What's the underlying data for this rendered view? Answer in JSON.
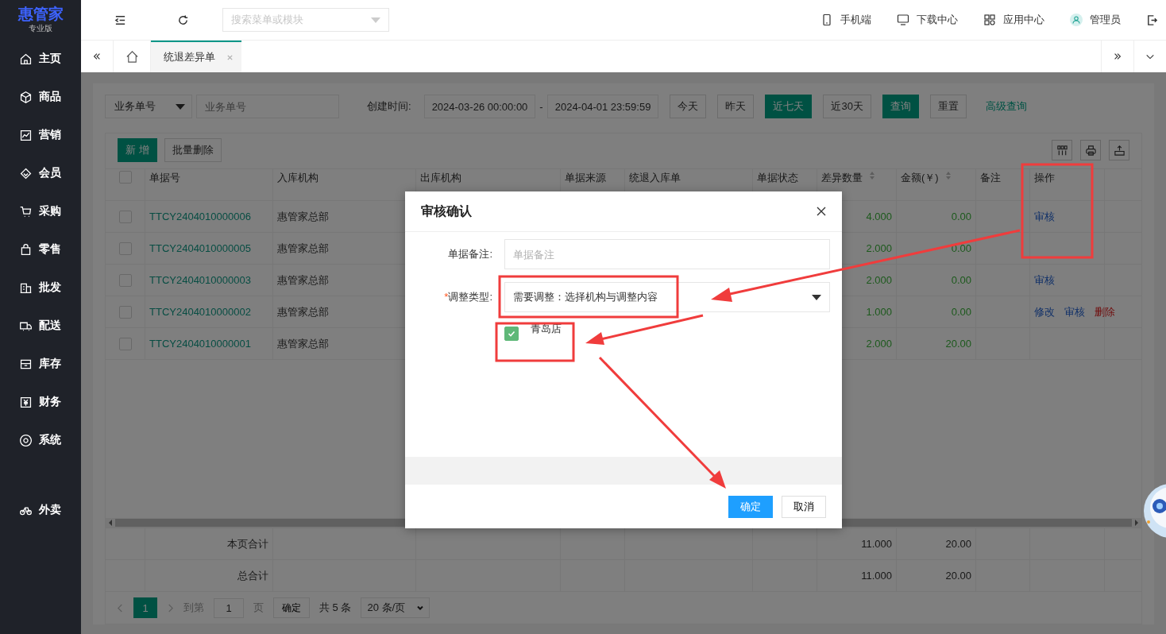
{
  "sidebar": {
    "logo": "惠管家",
    "edition": "专业版",
    "items": [
      {
        "label": "主页"
      },
      {
        "label": "商品"
      },
      {
        "label": "营销"
      },
      {
        "label": "会员"
      },
      {
        "label": "采购"
      },
      {
        "label": "零售"
      },
      {
        "label": "批发"
      },
      {
        "label": "配送"
      },
      {
        "label": "库存"
      },
      {
        "label": "财务"
      },
      {
        "label": "系统"
      }
    ],
    "extra_items": [
      {
        "label": "外卖"
      }
    ]
  },
  "header": {
    "search": {
      "placeholder": "搜索菜单或模块"
    },
    "actions": [
      {
        "label": "手机端"
      },
      {
        "label": "下载中心"
      },
      {
        "label": "应用中心"
      },
      {
        "label": "管理员"
      }
    ]
  },
  "tabs": [
    {
      "label": "统退差异单",
      "selected": true
    }
  ],
  "filters": {
    "field_select": "业务单号",
    "field_placeholder": "业务单号",
    "created_label": "创建时间:",
    "start": "2024-03-26 00:00:00",
    "separator": "-",
    "end": "2024-04-01 23:59:59",
    "quick_ranges": [
      {
        "label": "今天",
        "selected": false
      },
      {
        "label": "昨天",
        "selected": false
      },
      {
        "label": "近七天",
        "selected": true
      },
      {
        "label": "近30天",
        "selected": false
      }
    ],
    "query": "查询",
    "reset": "重置",
    "advanced": "高级查询"
  },
  "toolbar": {
    "add": "新 增",
    "batch_delete": "批量删除"
  },
  "table": {
    "all_checked": false,
    "columns": [
      {
        "label": "单据号",
        "sortable": false
      },
      {
        "label": "入库机构",
        "sortable": false
      },
      {
        "label": "出库机构",
        "sortable": false
      },
      {
        "label": "单据来源",
        "sortable": false
      },
      {
        "label": "统退入库单",
        "sortable": false
      },
      {
        "label": "单据状态",
        "sortable": false
      },
      {
        "label": "差异数量",
        "sortable": true
      },
      {
        "label": "金额(￥)",
        "sortable": true
      },
      {
        "label": "备注",
        "sortable": false
      },
      {
        "label": "操作",
        "sortable": false
      }
    ],
    "rows": [
      {
        "checked": false,
        "code": "TTCY2404010000006",
        "org": "惠管家总部",
        "qty": "4.000",
        "amount": "0.00",
        "actions": [
          {
            "label": "审核",
            "kind": "normal"
          }
        ]
      },
      {
        "checked": false,
        "code": "TTCY2404010000005",
        "org": "惠管家总部",
        "qty": "2.000",
        "amount": "0.00",
        "actions": []
      },
      {
        "checked": false,
        "code": "TTCY2404010000003",
        "org": "惠管家总部",
        "qty": "2.000",
        "amount": "0.00",
        "actions": [
          {
            "label": "审核",
            "kind": "normal"
          }
        ]
      },
      {
        "checked": false,
        "code": "TTCY2404010000002",
        "org": "惠管家总部",
        "qty": "1.000",
        "amount": "0.00",
        "actions": [
          {
            "label": "修改",
            "kind": "normal"
          },
          {
            "label": "审核",
            "kind": "normal"
          },
          {
            "label": "删除",
            "kind": "danger"
          }
        ]
      },
      {
        "checked": false,
        "code": "TTCY2404010000001",
        "org": "惠管家总部",
        "qty": "2.000",
        "amount": "20.00",
        "actions": []
      }
    ],
    "totals": [
      {
        "label": "本页合计",
        "qty": "11.000",
        "amount": "20.00"
      },
      {
        "label": "总合计",
        "qty": "11.000",
        "amount": "20.00"
      }
    ]
  },
  "pagination": {
    "page": "1",
    "goto": "到第",
    "input": "1",
    "page_unit": "页",
    "confirm": "确定",
    "total": "共 5 条",
    "page_size": "20 条/页"
  },
  "modal": {
    "title": "审核确认",
    "note_label": "单据备注:",
    "note_placeholder": "单据备注",
    "type_required_mark": "*",
    "type_label": "调整类型:",
    "type_value": "需要调整：选择机构与调整内容",
    "options": [
      {
        "label": "青岛店",
        "checked": true
      }
    ],
    "confirm": "确定",
    "cancel": "取消"
  }
}
